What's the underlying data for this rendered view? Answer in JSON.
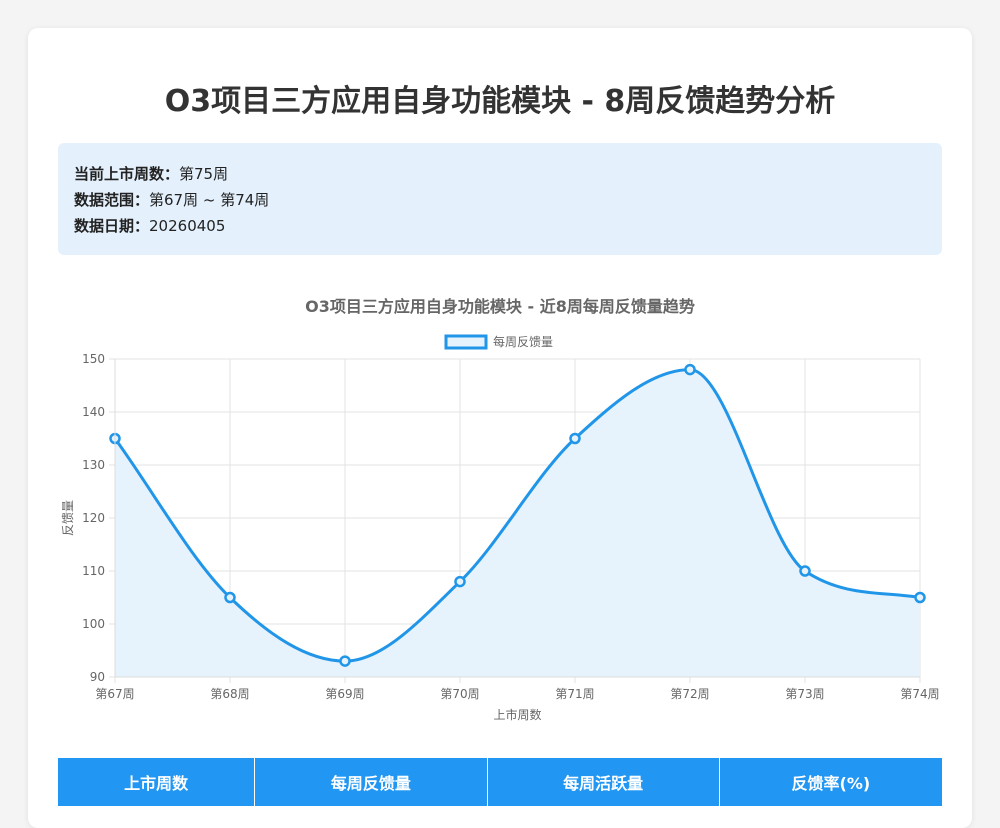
{
  "page": {
    "title": "O3项目三方应用自身功能模块 - 8周反馈趋势分析"
  },
  "info": [
    {
      "key": "当前上市周数：",
      "value": "第75周"
    },
    {
      "key": "数据范围：",
      "value": "第67周 ~ 第74周"
    },
    {
      "key": "数据日期：",
      "value": "20260405"
    }
  ],
  "chart_data": {
    "type": "line",
    "title": "O3项目三方应用自身功能模块 - 近8周每周反馈量趋势",
    "xlabel": "上市周数",
    "ylabel": "反馈量",
    "categories": [
      "第67周",
      "第68周",
      "第69周",
      "第70周",
      "第71周",
      "第72周",
      "第73周",
      "第74周"
    ],
    "series": [
      {
        "name": "每周反馈量",
        "values": [
          135,
          105,
          93,
          108,
          135,
          148,
          110,
          105
        ]
      }
    ],
    "ylim": [
      90,
      150
    ],
    "yticks": [
      90,
      100,
      110,
      120,
      130,
      140,
      150
    ],
    "grid": true,
    "legend": "top",
    "line_color": "#2196e8",
    "fill_color": "#e6f3fc"
  },
  "table": {
    "headers": [
      "上市周数",
      "每周反馈量",
      "每周活跃量",
      "反馈率(%)"
    ]
  }
}
